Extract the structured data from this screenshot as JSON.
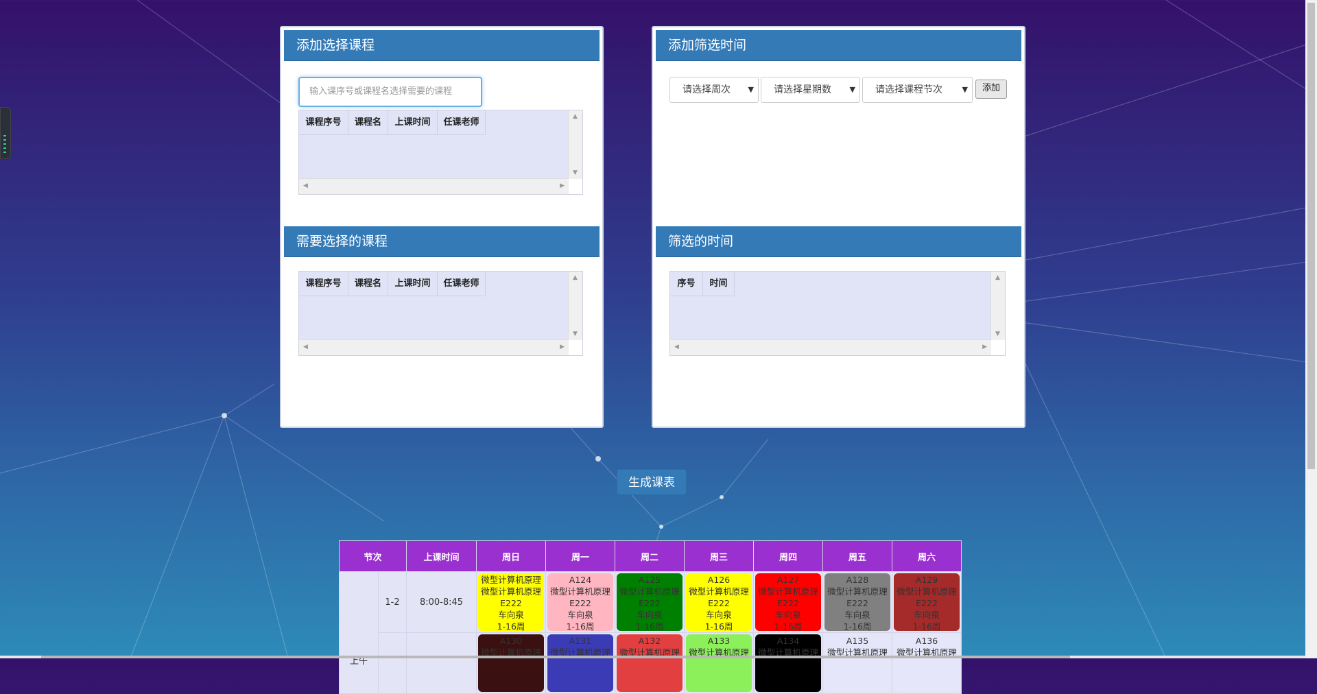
{
  "add_course_panel": {
    "title": "添加选择课程",
    "search_placeholder": "输入课序号或课程名选择需要的课程",
    "columns": [
      "课程序号",
      "课程名",
      "上课时间",
      "任课老师"
    ]
  },
  "filter_time_panel": {
    "title": "添加筛选时间",
    "week_select": "请选择周次",
    "weekday_select": "请选择星期数",
    "period_select": "请选择课程节次",
    "add_button": "添加"
  },
  "selected_courses_panel": {
    "title": "需要选择的课程",
    "columns": [
      "课程序号",
      "课程名",
      "上课时间",
      "任课老师"
    ]
  },
  "filtered_times_panel": {
    "title": "筛选的时间",
    "columns": [
      "序号",
      "时间"
    ]
  },
  "generate_button": "生成课表",
  "schedule": {
    "headers": [
      "节次",
      "上课时间",
      "周日",
      "周一",
      "周二",
      "周三",
      "周四",
      "周五",
      "周六"
    ],
    "section_label": "上午",
    "rows": [
      {
        "period": "1-2",
        "time": "8:00-8:45",
        "cells": [
          {
            "lines": [
              "微型计算机原理",
              "微型计算机原理",
              "E222",
              "车向泉",
              "1-16周"
            ],
            "bg": "#ffff00",
            "fg": "#333333"
          },
          {
            "lines": [
              "A124",
              "微型计算机原理",
              "E222",
              "车向泉",
              "1-16周"
            ],
            "bg": "#ffb6c1",
            "fg": "#333333"
          },
          {
            "lines": [
              "A125",
              "微型计算机原理",
              "E222",
              "车向泉",
              "1-16周"
            ],
            "bg": "#008000",
            "fg": "#333333"
          },
          {
            "lines": [
              "A126",
              "微型计算机原理",
              "E222",
              "车向泉",
              "1-16周"
            ],
            "bg": "#ffff00",
            "fg": "#333333"
          },
          {
            "lines": [
              "A127",
              "微型计算机原理",
              "E222",
              "车向泉",
              "1-16周"
            ],
            "bg": "#ff0000",
            "fg": "#333333"
          },
          {
            "lines": [
              "A128",
              "微型计算机原理",
              "E222",
              "车向泉",
              "1-16周"
            ],
            "bg": "#808080",
            "fg": "#333333"
          },
          {
            "lines": [
              "A129",
              "微型计算机原理",
              "E222",
              "车向泉",
              "1-16周"
            ],
            "bg": "#a52a2a",
            "fg": "#333333"
          }
        ]
      },
      {
        "period": "",
        "time": "",
        "cells": [
          {
            "lines": [
              "A130",
              "微型计算机原理"
            ],
            "bg": "#3a1010",
            "fg": "#333333"
          },
          {
            "lines": [
              "A131",
              "微型计算机原理"
            ],
            "bg": "#3b3bb5",
            "fg": "#333333"
          },
          {
            "lines": [
              "A132",
              "微型计算机原理"
            ],
            "bg": "#e24040",
            "fg": "#333333"
          },
          {
            "lines": [
              "A133",
              "微型计算机原理"
            ],
            "bg": "#8cf05a",
            "fg": "#333333"
          },
          {
            "lines": [
              "A134",
              "微型计算机原理"
            ],
            "bg": "#000000",
            "fg": "#333333"
          },
          {
            "lines": [
              "A135",
              "微型计算机原理"
            ],
            "bg": "#e6e6fa",
            "fg": "#333333"
          },
          {
            "lines": [
              "A136",
              "微型计算机原理"
            ],
            "bg": "#e6e6fa",
            "fg": "#333333"
          }
        ]
      }
    ]
  }
}
